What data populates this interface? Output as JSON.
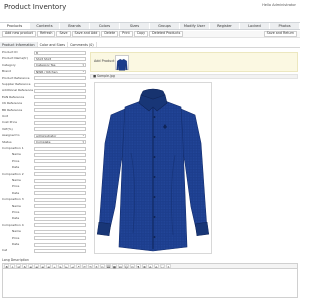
{
  "header": {
    "title": "Product Inventory",
    "hello": "Hello Administrator"
  },
  "nav": {
    "tabs": [
      "Products",
      "Contents",
      "Brands",
      "Colors",
      "Sizes",
      "Groups",
      "Modify User",
      "Register",
      "Locked Products",
      "Photos"
    ]
  },
  "toolbar": {
    "buttons": [
      "Add new product",
      "Refresh",
      "Save",
      "Save and Add",
      "Delete",
      "Print",
      "Copy",
      "Deleted Products"
    ],
    "save_return": "Save and Return"
  },
  "subtabs": [
    "Product Information",
    "Color and Sizes",
    "Comments (0)"
  ],
  "form": {
    "fields": [
      {
        "label": "Product ID",
        "value": "8"
      },
      {
        "label": "Product Name(tr)",
        "value": "Shirt Shirt"
      },
      {
        "label": "Category",
        "value": "Category Tes"
      },
      {
        "label": "Brand",
        "value": "NWR / Kitchen"
      },
      {
        "label": "Product Reference",
        "value": ""
      },
      {
        "label": "Supplier Reference",
        "value": ""
      },
      {
        "label": "Additional Reference",
        "value": ""
      },
      {
        "label": "EAN Reference",
        "value": ""
      },
      {
        "label": "CK Reference",
        "value": ""
      },
      {
        "label": "BR Reference",
        "value": ""
      },
      {
        "label": "Unit",
        "value": ""
      },
      {
        "label": "Cost Price",
        "value": ""
      },
      {
        "label": "VAT(%)",
        "value": ""
      },
      {
        "label": "Assigned to",
        "value": "administrator"
      },
      {
        "label": "Status",
        "value": "Complete"
      },
      {
        "label": "Composition 1",
        "value": ""
      },
      {
        "label": "Name",
        "value": ""
      },
      {
        "label": "Price",
        "value": ""
      },
      {
        "label": "Date",
        "value": ""
      },
      {
        "label": "Composition 2",
        "value": ""
      },
      {
        "label": "Name",
        "value": ""
      },
      {
        "label": "Price",
        "value": ""
      },
      {
        "label": "Date",
        "value": ""
      },
      {
        "label": "Composition 3",
        "value": ""
      },
      {
        "label": "Name",
        "value": ""
      },
      {
        "label": "Price",
        "value": ""
      },
      {
        "label": "Date",
        "value": ""
      },
      {
        "label": "Composition 4",
        "value": ""
      },
      {
        "label": "Name",
        "value": ""
      },
      {
        "label": "Price",
        "value": ""
      },
      {
        "label": "Date",
        "value": ""
      },
      {
        "label": "Cat",
        "value": ""
      }
    ],
    "selects": [
      2,
      3,
      13,
      14
    ],
    "indented": [
      16,
      17,
      18,
      20,
      21,
      22,
      24,
      25,
      26,
      28,
      29,
      30
    ]
  },
  "images": {
    "add_label": "Add Product",
    "caption": "■ Sample.jpg"
  },
  "description": {
    "label": "Long Description",
    "tools": [
      "B",
      "I",
      "U",
      "S",
      "≡",
      "≡",
      "≡",
      "≡",
      "•",
      "1.",
      "⇤",
      "⇥",
      "❝",
      "↶",
      "↷",
      "⚭",
      "✂",
      "⌧",
      "▦",
      "Ω",
      "☺",
      "▭",
      "¶",
      "≣",
      "A",
      "A",
      "⛶",
      "?"
    ]
  },
  "colors": {
    "shirt": "#1c3d8c",
    "shirt_dark": "#142e6e",
    "nav_bg": "#eceef0",
    "add_bar": "#fbf8e2"
  }
}
